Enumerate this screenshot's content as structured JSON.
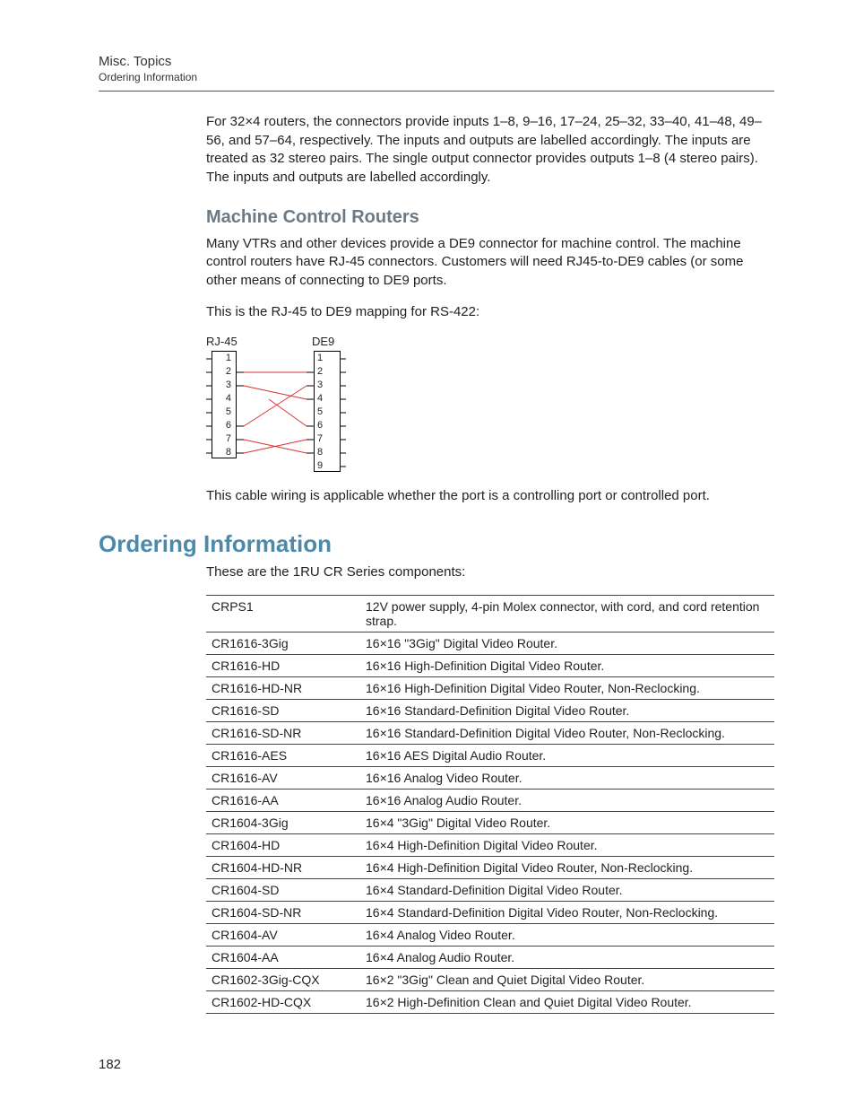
{
  "header": {
    "title": "Misc. Topics",
    "subtitle": "Ordering Information"
  },
  "intro_para": "For 32×4 routers, the connectors provide inputs 1–8, 9–16, 17–24, 25–32, 33–40, 41–48, 49–56, and 57–64, respectively. The inputs and outputs are labelled accordingly. The inputs are treated as 32 stereo pairs. The single output connector provides outputs 1–8 (4 stereo pairs). The inputs and outputs are labelled accordingly.",
  "mcr": {
    "heading": "Machine Control Routers",
    "p1": "Many VTRs and other devices provide a DE9 connector for machine control. The machine control routers have RJ-45 connectors. Customers will need RJ45-to-DE9 cables (or some other means of connecting to DE9 ports.",
    "p2": "This is the RJ-45 to DE9 mapping for RS-422:",
    "diagram": {
      "left_label": "RJ-45",
      "right_label": "DE9",
      "left_pins": [
        "1",
        "2",
        "3",
        "4",
        "5",
        "6",
        "7",
        "8"
      ],
      "right_pins": [
        "1",
        "2",
        "3",
        "4",
        "5",
        "6",
        "7",
        "8",
        "9"
      ]
    },
    "p3": "This cable wiring is applicable whether the port is a controlling port or controlled port."
  },
  "ordering": {
    "heading": "Ordering Information",
    "intro": "These are the 1RU CR Series components:",
    "rows": [
      {
        "code": "CRPS1",
        "desc": "12V power supply, 4-pin Molex connector, with cord, and cord retention strap."
      },
      {
        "code": "CR1616-3Gig",
        "desc": "16×16 \"3Gig\" Digital Video Router."
      },
      {
        "code": "CR1616-HD",
        "desc": "16×16 High-Definition Digital Video Router."
      },
      {
        "code": "CR1616-HD-NR",
        "desc": "16×16 High-Definition Digital Video Router, Non-Reclocking."
      },
      {
        "code": "CR1616-SD",
        "desc": "16×16 Standard-Definition Digital Video Router."
      },
      {
        "code": "CR1616-SD-NR",
        "desc": "16×16 Standard-Definition Digital Video Router, Non-Reclocking."
      },
      {
        "code": "CR1616-AES",
        "desc": "16×16 AES Digital Audio Router."
      },
      {
        "code": "CR1616-AV",
        "desc": "16×16 Analog Video Router."
      },
      {
        "code": "CR1616-AA",
        "desc": "16×16 Analog Audio Router."
      },
      {
        "code": "CR1604-3Gig",
        "desc": "16×4 \"3Gig\" Digital Video Router."
      },
      {
        "code": "CR1604-HD",
        "desc": "16×4 High-Definition Digital Video Router."
      },
      {
        "code": "CR1604-HD-NR",
        "desc": "16×4 High-Definition Digital Video Router, Non-Reclocking."
      },
      {
        "code": "CR1604-SD",
        "desc": "16×4 Standard-Definition Digital Video Router."
      },
      {
        "code": "CR1604-SD-NR",
        "desc": "16×4 Standard-Definition Digital Video Router, Non-Reclocking."
      },
      {
        "code": "CR1604-AV",
        "desc": "16×4 Analog Video Router."
      },
      {
        "code": "CR1604-AA",
        "desc": "16×4 Analog Audio Router."
      },
      {
        "code": "CR1602-3Gig-CQX",
        "desc": "16×2 \"3Gig\" Clean and Quiet Digital Video Router."
      },
      {
        "code": "CR1602-HD-CQX",
        "desc": "16×2 High-Definition Clean and Quiet Digital Video Router."
      }
    ]
  },
  "page_number": "182"
}
